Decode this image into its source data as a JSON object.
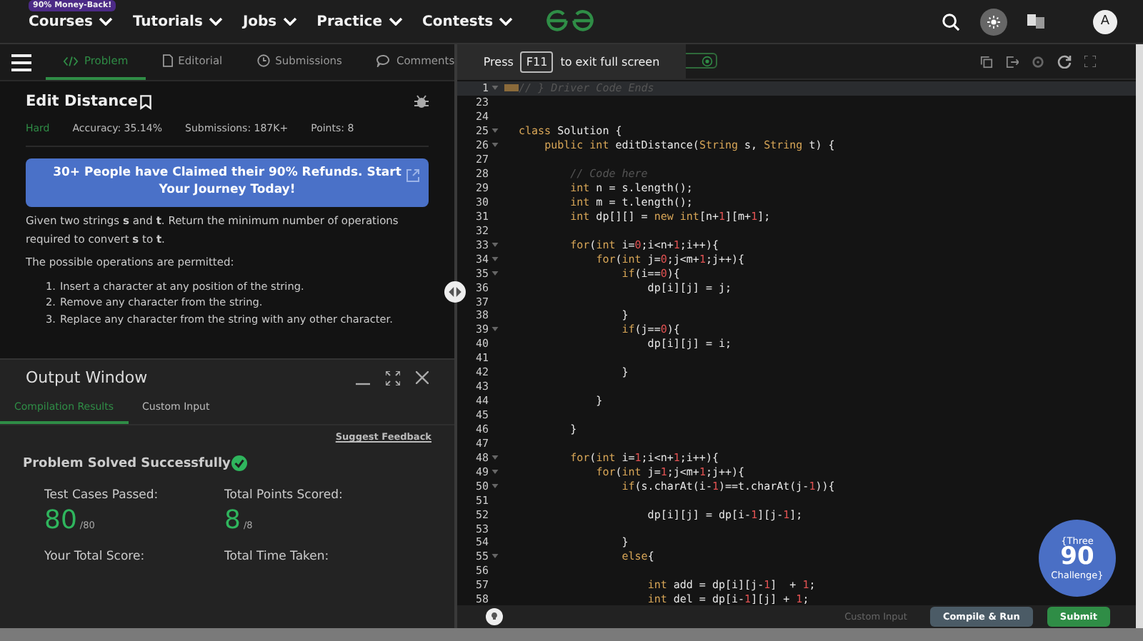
{
  "nav": {
    "badge": "90% Money-Back!",
    "items": [
      "Courses",
      "Tutorials",
      "Jobs",
      "Practice",
      "Contests"
    ],
    "avatar": "A"
  },
  "toolbar": {
    "tabs": [
      {
        "label": "Problem",
        "kind": "code",
        "selected": true
      },
      {
        "label": "Editorial",
        "kind": "doc",
        "selected": false
      },
      {
        "label": "Submissions",
        "kind": "clock",
        "selected": false
      },
      {
        "label": "Comments",
        "kind": "chat",
        "selected": false
      }
    ],
    "toast": {
      "before": "Press",
      "key": "F11",
      "after": "to exit full screen"
    }
  },
  "problem": {
    "title": "Edit Distance",
    "difficulty": "Hard",
    "stats": [
      "Accuracy: 35.14%",
      "Submissions: 187K+",
      "Points: 8"
    ],
    "banner": "30+ People have Claimed their 90% Refunds. Start Your Journey Today!",
    "description": [
      "Given two strings **s** and **t**. Return the minimum number of operations required to convert **s** to **t**.",
      "The possible operations are permitted:"
    ],
    "operations": [
      {
        "marker": "1.",
        "text": "Insert a character at any position of the string."
      },
      {
        "marker": "2.",
        "text": "Remove any character from the string."
      },
      {
        "marker": "3.",
        "text": "Replace any character from the string with any other character."
      }
    ]
  },
  "output": {
    "title": "Output Window",
    "tabs": [
      {
        "label": "Compilation Results",
        "selected": true
      },
      {
        "label": "Custom Input",
        "selected": false
      }
    ],
    "feedback_link": "Suggest Feedback",
    "status": "Problem Solved Successfully",
    "stats": [
      {
        "label": "Test Cases Passed:",
        "value": "80",
        "total": "/80"
      },
      {
        "label": "Total Points Scored:",
        "value": "8",
        "total": "/8"
      },
      {
        "label": "Your Total Score:"
      },
      {
        "label": "Total Time Taken:"
      }
    ]
  },
  "editor": {
    "lines": [
      {
        "number": "1",
        "text": "// } Driver Code Ends",
        "fold": true,
        "highlighted": true
      },
      {
        "number": "23",
        "fold": false,
        "highlighted": false
      },
      {
        "number": "24",
        "fold": false,
        "highlighted": false
      },
      {
        "number": "25",
        "text": "class Solution {",
        "fold": true,
        "highlighted": false
      },
      {
        "number": "26",
        "text": "    public int editDistance(String s, String t) {",
        "fold": true,
        "highlighted": false
      },
      {
        "number": "27",
        "fold": false,
        "highlighted": false
      },
      {
        "number": "28",
        "text": "        // Code here",
        "fold": false,
        "highlighted": false
      },
      {
        "number": "29",
        "text": "        int n = s.length();",
        "fold": false,
        "highlighted": false
      },
      {
        "number": "30",
        "text": "        int m = t.length();",
        "fold": false,
        "highlighted": false
      },
      {
        "number": "31",
        "text": "        int dp[][] = new int[n+1][m+1];",
        "fold": false,
        "highlighted": false
      },
      {
        "number": "32",
        "fold": false,
        "highlighted": false
      },
      {
        "number": "33",
        "text": "        for(int i=0;i<n+1;i++){",
        "fold": true,
        "highlighted": false
      },
      {
        "number": "34",
        "text": "            for(int j=0;j<m+1;j++){",
        "fold": true,
        "highlighted": false
      },
      {
        "number": "35",
        "text": "                if(i==0){",
        "fold": true,
        "highlighted": false
      },
      {
        "number": "36",
        "text": "                    dp[i][j] = j;",
        "fold": false,
        "highlighted": false
      },
      {
        "number": "37",
        "fold": false,
        "highlighted": false
      },
      {
        "number": "38",
        "text": "                }",
        "fold": false,
        "highlighted": false
      },
      {
        "number": "39",
        "text": "                if(j==0){",
        "fold": true,
        "highlighted": false
      },
      {
        "number": "40",
        "text": "                    dp[i][j] = i;",
        "fold": false,
        "highlighted": false
      },
      {
        "number": "41",
        "fold": false,
        "highlighted": false
      },
      {
        "number": "42",
        "text": "                }",
        "fold": false,
        "highlighted": false
      },
      {
        "number": "43",
        "fold": false,
        "highlighted": false
      },
      {
        "number": "44",
        "text": "            }",
        "fold": false,
        "highlighted": false
      },
      {
        "number": "45",
        "fold": false,
        "highlighted": false
      },
      {
        "number": "46",
        "text": "        }",
        "fold": false,
        "highlighted": false
      },
      {
        "number": "47",
        "fold": false,
        "highlighted": false
      },
      {
        "number": "48",
        "text": "        for(int i=1;i<n+1;i++){",
        "fold": true,
        "highlighted": false
      },
      {
        "number": "49",
        "text": "            for(int j=1;j<m+1;j++){",
        "fold": true,
        "highlighted": false
      },
      {
        "number": "50",
        "text": "                if(s.charAt(i-1)==t.charAt(j-1)){",
        "fold": true,
        "highlighted": false
      },
      {
        "number": "51",
        "fold": false,
        "highlighted": false
      },
      {
        "number": "52",
        "text": "                    dp[i][j] = dp[i-1][j-1];",
        "fold": false,
        "highlighted": false
      },
      {
        "number": "53",
        "fold": false,
        "highlighted": false
      },
      {
        "number": "54",
        "text": "                }",
        "fold": false,
        "highlighted": false
      },
      {
        "number": "55",
        "text": "                else{",
        "fold": true,
        "highlighted": false
      },
      {
        "number": "56",
        "fold": false,
        "highlighted": false
      },
      {
        "number": "57",
        "text": "                    int add = dp[i][j-1]  + 1;",
        "fold": false,
        "highlighted": false
      },
      {
        "number": "58",
        "text": "                    int del = dp[i-1][j] + 1;",
        "fold": false,
        "highlighted": false
      }
    ],
    "footer": {
      "custom_input": "Custom Input",
      "compile": "Compile & Run",
      "submit": "Submit"
    }
  },
  "promo": {
    "top": "{Three",
    "number": "90",
    "bottom": "Challenge}"
  }
}
